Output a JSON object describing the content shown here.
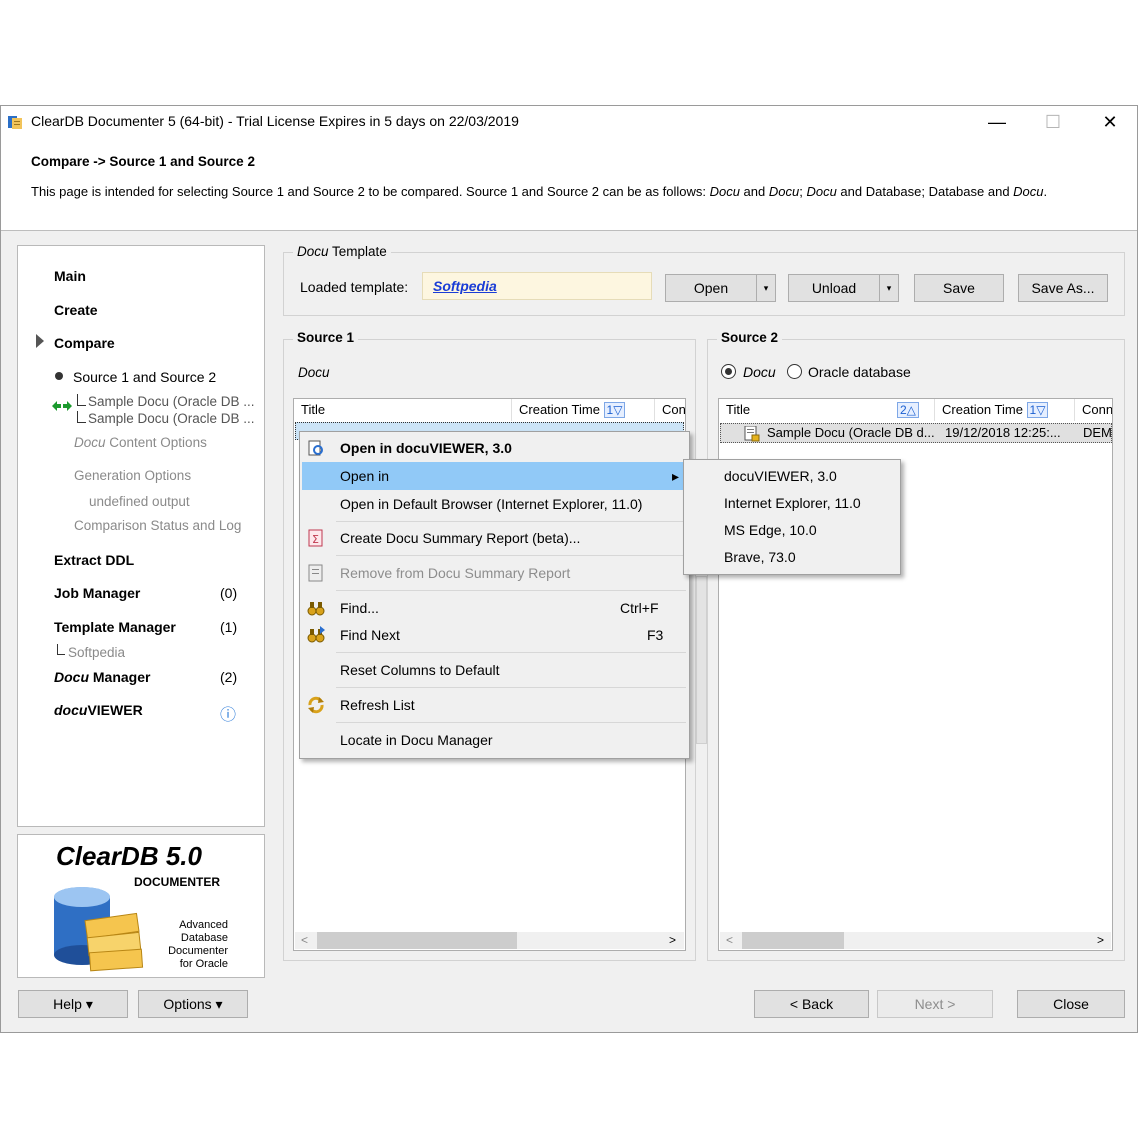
{
  "window": {
    "title": "ClearDB Documenter 5 (64-bit) - Trial License Expires in 5 days on 22/03/2019",
    "minimize": "—",
    "maximize": "☐",
    "close": "✕"
  },
  "header": {
    "heading": "Compare -> Source 1 and Source 2",
    "desc_parts": [
      "This page is intended for selecting Source 1 and Source 2 to be compared. Source 1 and Source 2 can be as follows: ",
      "Docu",
      " and ",
      "Docu",
      "; ",
      "Docu",
      " and Database; Database and ",
      "Docu",
      "."
    ]
  },
  "sidebar": {
    "main": "Main",
    "create": "Create",
    "compare": "Compare",
    "source_pair": "Source 1 and Source 2",
    "sample1": "Sample Docu (Oracle DB ...",
    "sample2": "Sample Docu (Oracle DB ...",
    "docu_word": "Docu",
    "content_options": " Content Options",
    "generation_options": "Generation Options",
    "undefined_output": "undefined output",
    "comparison_status": "Comparison Status and Log",
    "extract_ddl": "Extract DDL",
    "job_manager": "Job Manager",
    "job_count": "(0)",
    "template_manager": "Template Manager",
    "template_count": "(1)",
    "softpedia": "Softpedia",
    "docu_manager_word": "Docu",
    "docu_manager": " Manager",
    "docu_count": "(2)",
    "docuviewer_docu": "docu",
    "docuviewer_viewer": "VIEWER",
    "info_icon": "ⓘ"
  },
  "logo": {
    "brand": "ClearDB 5.0",
    "product": "DOCUMENTER",
    "tag1": "Advanced",
    "tag2": "Database",
    "tag3": "Documenter",
    "tag4": "for Oracle"
  },
  "template": {
    "group_docu": "Docu",
    "group_label": " Template",
    "loaded_label": "Loaded template:",
    "loaded_value": "Softpedia",
    "open": "Open",
    "unload": "Unload",
    "save": "Save",
    "save_as": "Save As...",
    "dropdown_glyph": "▾"
  },
  "source1": {
    "label": "Source 1",
    "kind": "Docu",
    "col_title": "Title",
    "col_created": "Creation Time",
    "col_created_sort": "1▽",
    "col_conn": "Conn",
    "scroll_left": "<",
    "scroll_right": ">"
  },
  "source2": {
    "label": "Source 2",
    "opt_docu": "Docu",
    "opt_oracle": "Oracle database",
    "col_title": "Title",
    "col_title_sort": "2△",
    "col_created": "Creation Time",
    "col_created_sort": "1▽",
    "col_conn": "Conn",
    "row_title": "Sample Docu (Oracle DB d...",
    "row_created": "19/12/2018 12:25:...",
    "row_conn": "DEMO",
    "scroll_left": "<",
    "scroll_right": ">"
  },
  "context_menu": {
    "open_in_viewer": "Open in docuVIEWER, 3.0",
    "open_in": "Open in",
    "open_browser": "Open in Default Browser (Internet Explorer, 11.0)",
    "create_summary": "Create Docu Summary Report (beta)...",
    "remove_summary": "Remove from Docu Summary Report",
    "find": "Find...",
    "find_sc": "Ctrl+F",
    "find_next": "Find Next",
    "find_next_sc": "F3",
    "reset_columns": "Reset Columns to Default",
    "refresh": "Refresh List",
    "locate": "Locate in Docu Manager",
    "arrow": "▸"
  },
  "submenu": {
    "items": [
      "docuVIEWER, 3.0",
      "Internet Explorer, 11.0",
      "MS Edge, 10.0",
      "Brave, 73.0"
    ]
  },
  "footer": {
    "help": "Help ▾",
    "options": "Options ▾",
    "back": "< Back",
    "next": "Next >",
    "close": "Close"
  },
  "colors": {
    "highlight": "#91c9f7",
    "link": "#1a3cd6",
    "template_bg": "#fdf6e0"
  }
}
